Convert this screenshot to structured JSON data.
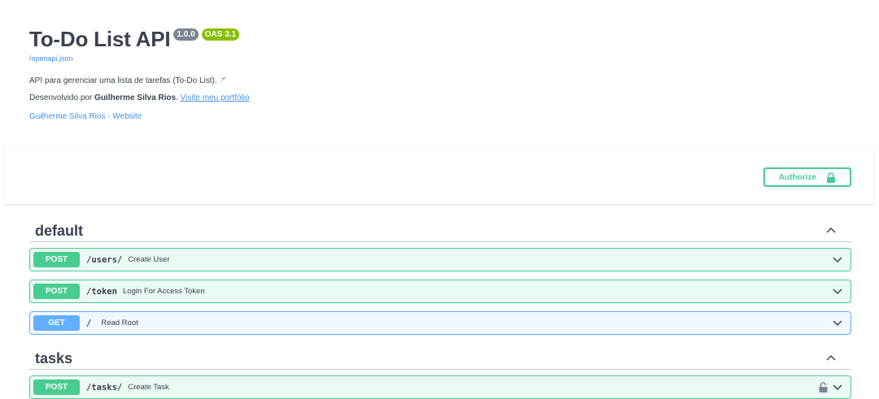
{
  "info": {
    "title": "To-Do List API",
    "version_badge": "1.0.0",
    "oas_badge": "OAS 3.1",
    "spec_link": "/openapi.json",
    "description_line1": "API para gerenciar uma lista de tarefas (To-Do List).",
    "description_line2_prefix": "Desenvolvido por ",
    "author_name": "Guilherme Silva Rios",
    "description_line2_period": ".",
    "portfolio_link": "Visite meu portfólio",
    "contact_link": "Guilherme Silva Rios - Website"
  },
  "auth": {
    "authorize_label": "Authorize",
    "icon": "lock-icon"
  },
  "colors": {
    "post": "#49cc90",
    "get": "#61affe",
    "text": "#3b4151",
    "link": "#4990e2"
  },
  "tags": [
    {
      "name": "default",
      "operations": [
        {
          "method": "POST",
          "path": "/users/",
          "summary": "Create User"
        },
        {
          "method": "POST",
          "path": "/token",
          "summary": "Login For Access Token"
        },
        {
          "method": "GET",
          "path": "/",
          "summary": "Read Root"
        }
      ]
    },
    {
      "name": "tasks",
      "operations": [
        {
          "method": "POST",
          "path": "/tasks/",
          "summary": "Create Task",
          "locked": true
        }
      ]
    }
  ]
}
